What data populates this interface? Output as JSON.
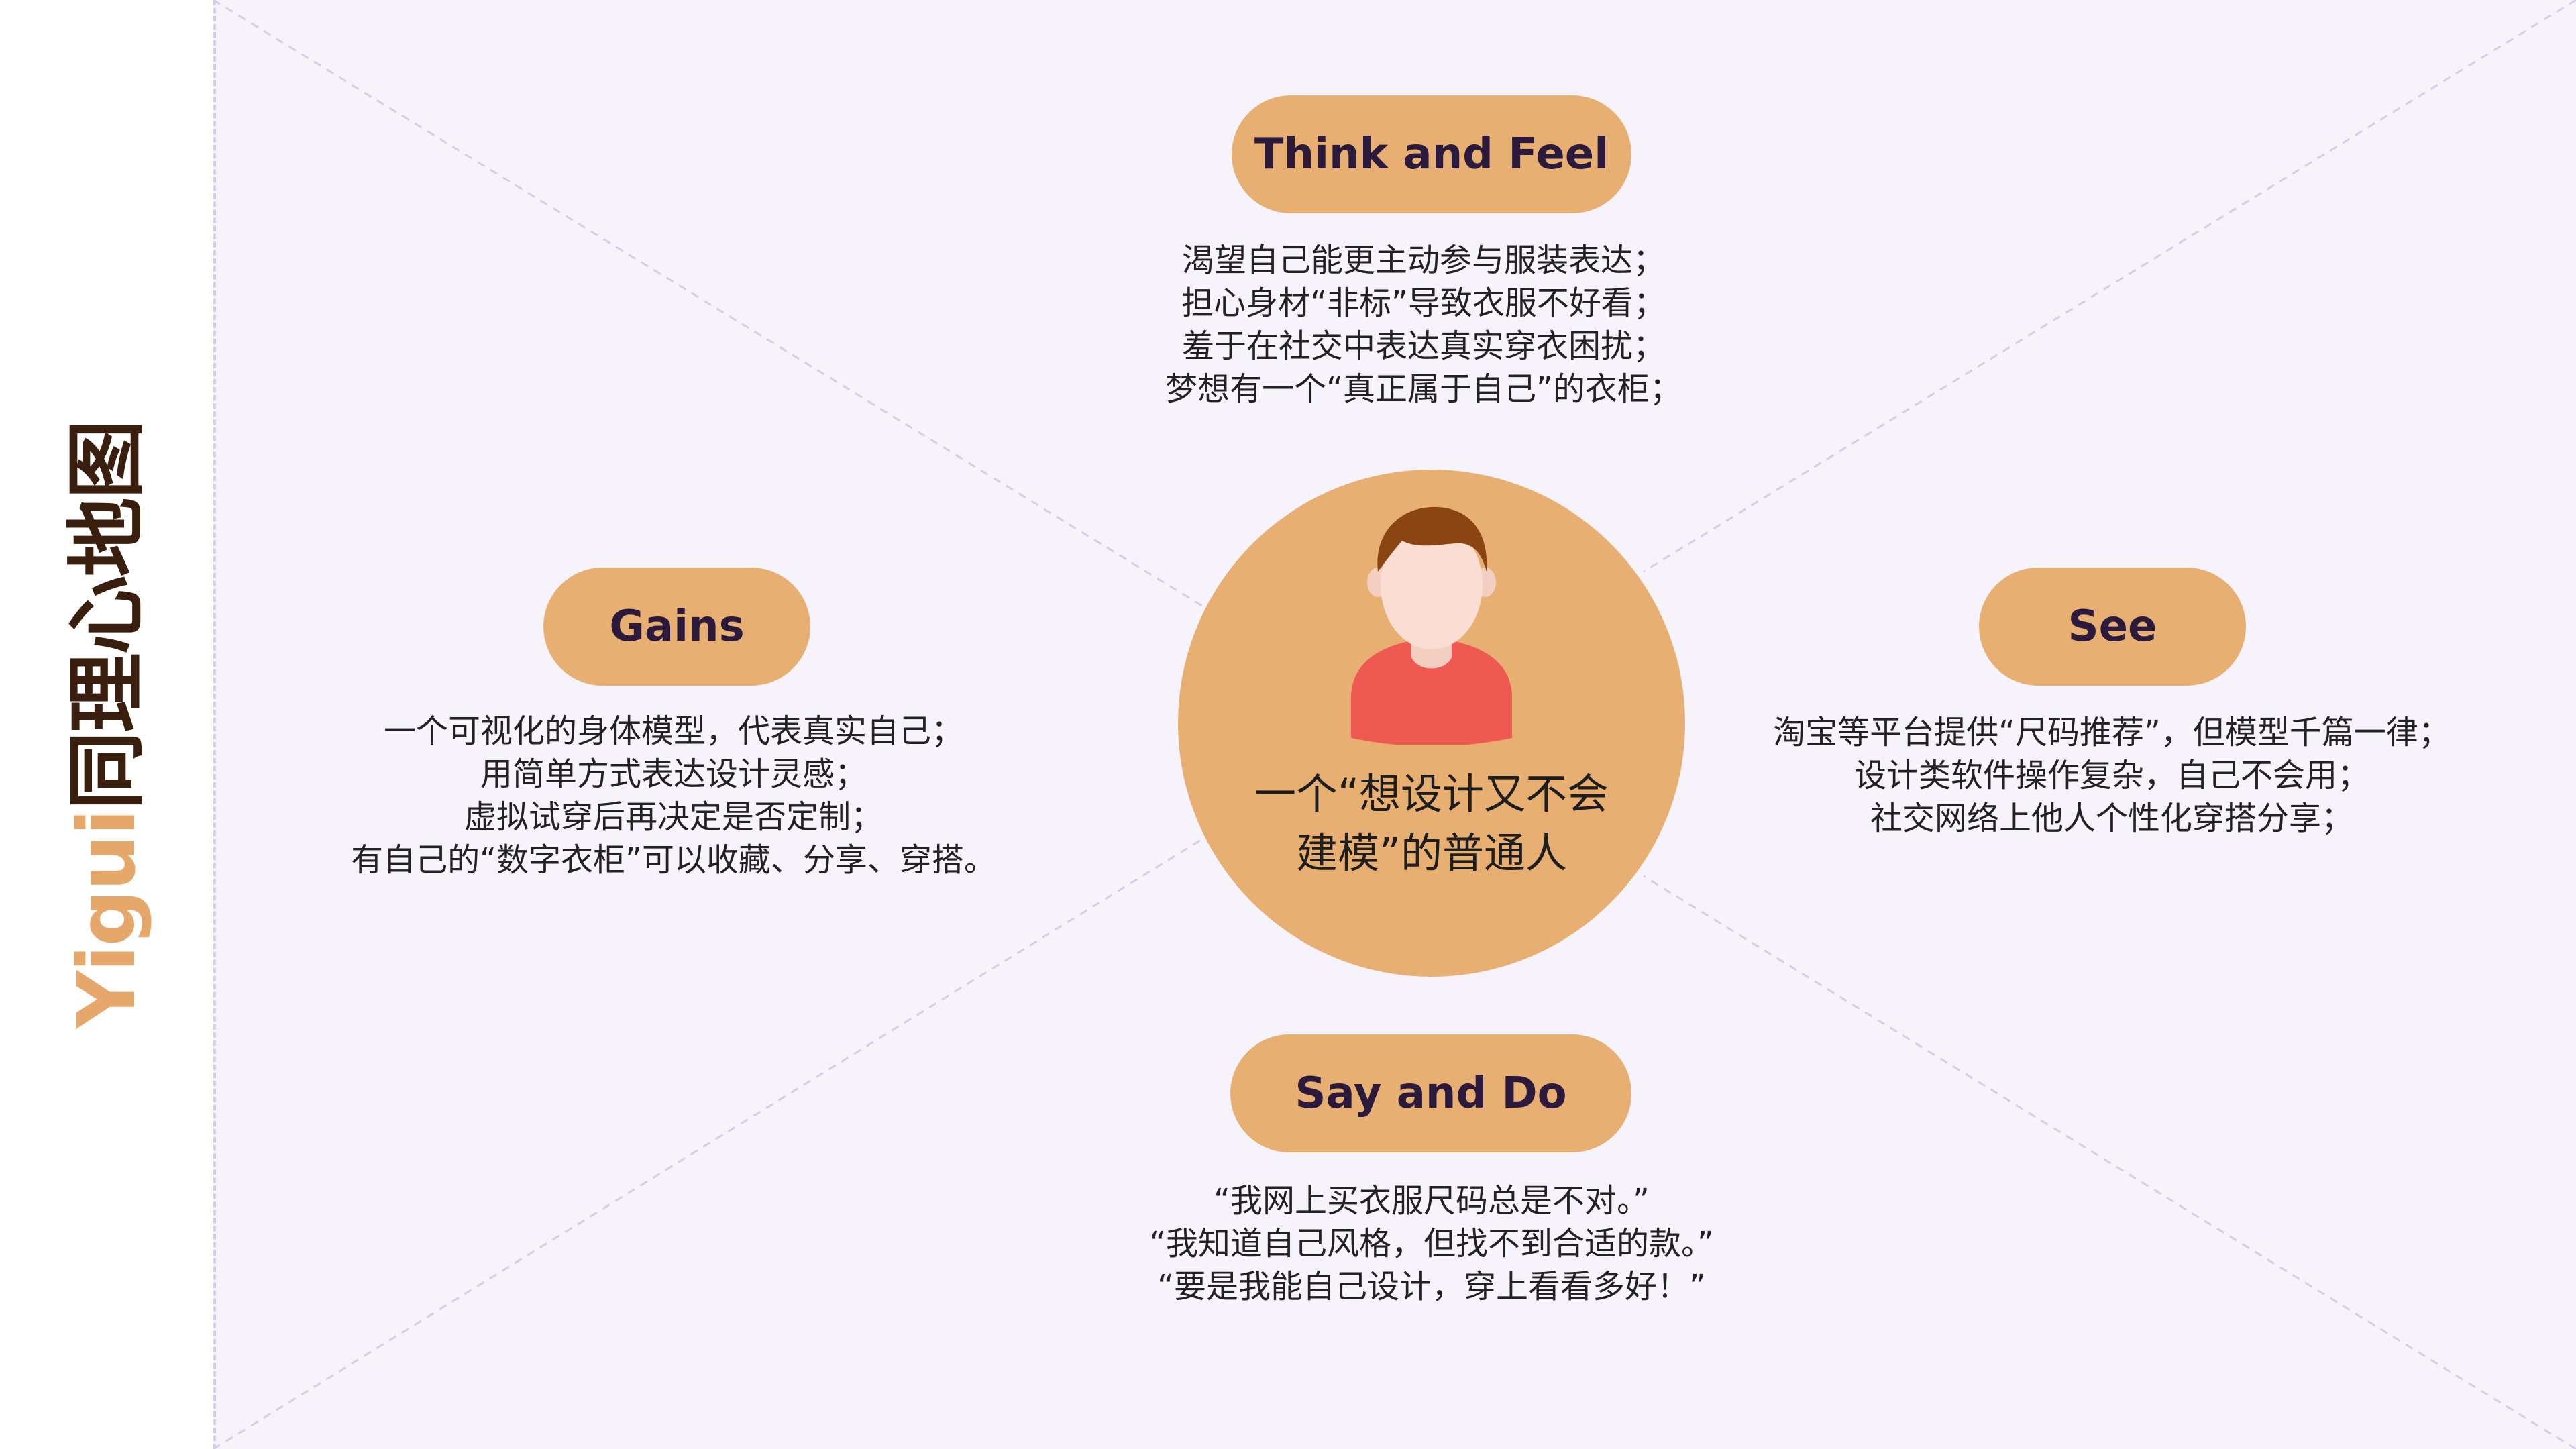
{
  "sidebar": {
    "brand": "Yigui",
    "title_rest": "同理心地图"
  },
  "center": {
    "avatar_icon": "person-avatar-icon",
    "label_line1": "一个“想设计又不会",
    "label_line2": "建模”的普通人"
  },
  "quadrants": {
    "think_and_feel": {
      "title": "Think and Feel",
      "lines": [
        "渴望自己能更主动参与服装表达；",
        "担心身材“非标”导致衣服不好看；",
        "羞于在社交中表达真实穿衣困扰；",
        "梦想有一个“真正属于自己”的衣柜；"
      ]
    },
    "gains": {
      "title": "Gains",
      "lines": [
        "一个可视化的身体模型，代表真实自己；",
        "用简单方式表达设计灵感；",
        "虚拟试穿后再决定是否定制；",
        "有自己的“数字衣柜”可以收藏、分享、穿搭。"
      ]
    },
    "see": {
      "title": "See",
      "lines": [
        "淘宝等平台提供“尺码推荐”，但模型千篇一律；",
        "设计类软件操作复杂，自己不会用；",
        "社交网络上他人个性化穿搭分享；"
      ]
    },
    "say_and_do": {
      "title": "Say and Do",
      "lines": [
        "“我网上买衣服尺码总是不对。”",
        "“我知道自己风格，但找不到合适的款。”",
        "“要是我能自己设计，穿上看看多好！”"
      ]
    }
  },
  "colors": {
    "accent": "#E8AF73",
    "brand_text": "#E5A76A",
    "title_dark": "#3A1F0F",
    "canvas_bg": "#F6F3FA",
    "guide_lines": "#D5CEEA",
    "pill_text": "#2B1A3C"
  }
}
